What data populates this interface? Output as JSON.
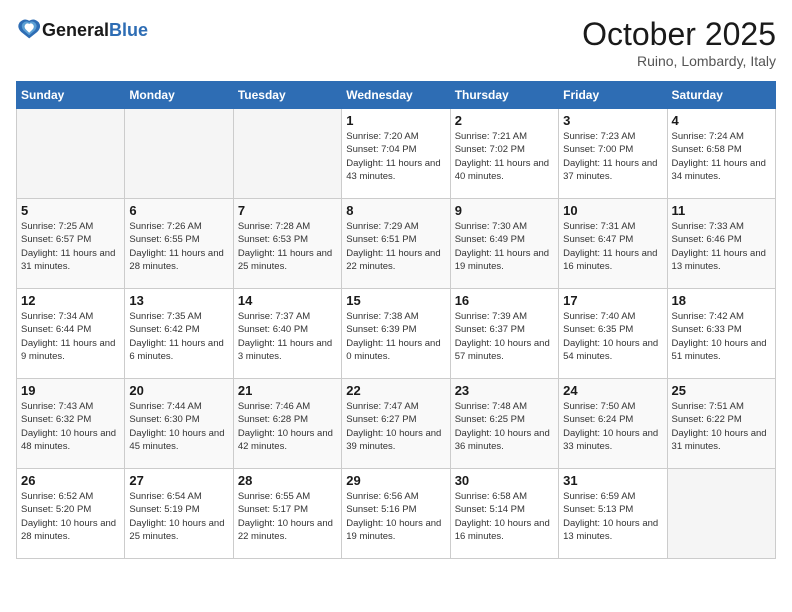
{
  "header": {
    "logo_general": "General",
    "logo_blue": "Blue",
    "month_title": "October 2025",
    "location": "Ruino, Lombardy, Italy"
  },
  "days_of_week": [
    "Sunday",
    "Monday",
    "Tuesday",
    "Wednesday",
    "Thursday",
    "Friday",
    "Saturday"
  ],
  "weeks": [
    [
      {
        "day": "",
        "info": ""
      },
      {
        "day": "",
        "info": ""
      },
      {
        "day": "",
        "info": ""
      },
      {
        "day": "1",
        "info": "Sunrise: 7:20 AM\nSunset: 7:04 PM\nDaylight: 11 hours and 43 minutes."
      },
      {
        "day": "2",
        "info": "Sunrise: 7:21 AM\nSunset: 7:02 PM\nDaylight: 11 hours and 40 minutes."
      },
      {
        "day": "3",
        "info": "Sunrise: 7:23 AM\nSunset: 7:00 PM\nDaylight: 11 hours and 37 minutes."
      },
      {
        "day": "4",
        "info": "Sunrise: 7:24 AM\nSunset: 6:58 PM\nDaylight: 11 hours and 34 minutes."
      }
    ],
    [
      {
        "day": "5",
        "info": "Sunrise: 7:25 AM\nSunset: 6:57 PM\nDaylight: 11 hours and 31 minutes."
      },
      {
        "day": "6",
        "info": "Sunrise: 7:26 AM\nSunset: 6:55 PM\nDaylight: 11 hours and 28 minutes."
      },
      {
        "day": "7",
        "info": "Sunrise: 7:28 AM\nSunset: 6:53 PM\nDaylight: 11 hours and 25 minutes."
      },
      {
        "day": "8",
        "info": "Sunrise: 7:29 AM\nSunset: 6:51 PM\nDaylight: 11 hours and 22 minutes."
      },
      {
        "day": "9",
        "info": "Sunrise: 7:30 AM\nSunset: 6:49 PM\nDaylight: 11 hours and 19 minutes."
      },
      {
        "day": "10",
        "info": "Sunrise: 7:31 AM\nSunset: 6:47 PM\nDaylight: 11 hours and 16 minutes."
      },
      {
        "day": "11",
        "info": "Sunrise: 7:33 AM\nSunset: 6:46 PM\nDaylight: 11 hours and 13 minutes."
      }
    ],
    [
      {
        "day": "12",
        "info": "Sunrise: 7:34 AM\nSunset: 6:44 PM\nDaylight: 11 hours and 9 minutes."
      },
      {
        "day": "13",
        "info": "Sunrise: 7:35 AM\nSunset: 6:42 PM\nDaylight: 11 hours and 6 minutes."
      },
      {
        "day": "14",
        "info": "Sunrise: 7:37 AM\nSunset: 6:40 PM\nDaylight: 11 hours and 3 minutes."
      },
      {
        "day": "15",
        "info": "Sunrise: 7:38 AM\nSunset: 6:39 PM\nDaylight: 11 hours and 0 minutes."
      },
      {
        "day": "16",
        "info": "Sunrise: 7:39 AM\nSunset: 6:37 PM\nDaylight: 10 hours and 57 minutes."
      },
      {
        "day": "17",
        "info": "Sunrise: 7:40 AM\nSunset: 6:35 PM\nDaylight: 10 hours and 54 minutes."
      },
      {
        "day": "18",
        "info": "Sunrise: 7:42 AM\nSunset: 6:33 PM\nDaylight: 10 hours and 51 minutes."
      }
    ],
    [
      {
        "day": "19",
        "info": "Sunrise: 7:43 AM\nSunset: 6:32 PM\nDaylight: 10 hours and 48 minutes."
      },
      {
        "day": "20",
        "info": "Sunrise: 7:44 AM\nSunset: 6:30 PM\nDaylight: 10 hours and 45 minutes."
      },
      {
        "day": "21",
        "info": "Sunrise: 7:46 AM\nSunset: 6:28 PM\nDaylight: 10 hours and 42 minutes."
      },
      {
        "day": "22",
        "info": "Sunrise: 7:47 AM\nSunset: 6:27 PM\nDaylight: 10 hours and 39 minutes."
      },
      {
        "day": "23",
        "info": "Sunrise: 7:48 AM\nSunset: 6:25 PM\nDaylight: 10 hours and 36 minutes."
      },
      {
        "day": "24",
        "info": "Sunrise: 7:50 AM\nSunset: 6:24 PM\nDaylight: 10 hours and 33 minutes."
      },
      {
        "day": "25",
        "info": "Sunrise: 7:51 AM\nSunset: 6:22 PM\nDaylight: 10 hours and 31 minutes."
      }
    ],
    [
      {
        "day": "26",
        "info": "Sunrise: 6:52 AM\nSunset: 5:20 PM\nDaylight: 10 hours and 28 minutes."
      },
      {
        "day": "27",
        "info": "Sunrise: 6:54 AM\nSunset: 5:19 PM\nDaylight: 10 hours and 25 minutes."
      },
      {
        "day": "28",
        "info": "Sunrise: 6:55 AM\nSunset: 5:17 PM\nDaylight: 10 hours and 22 minutes."
      },
      {
        "day": "29",
        "info": "Sunrise: 6:56 AM\nSunset: 5:16 PM\nDaylight: 10 hours and 19 minutes."
      },
      {
        "day": "30",
        "info": "Sunrise: 6:58 AM\nSunset: 5:14 PM\nDaylight: 10 hours and 16 minutes."
      },
      {
        "day": "31",
        "info": "Sunrise: 6:59 AM\nSunset: 5:13 PM\nDaylight: 10 hours and 13 minutes."
      },
      {
        "day": "",
        "info": ""
      }
    ]
  ]
}
